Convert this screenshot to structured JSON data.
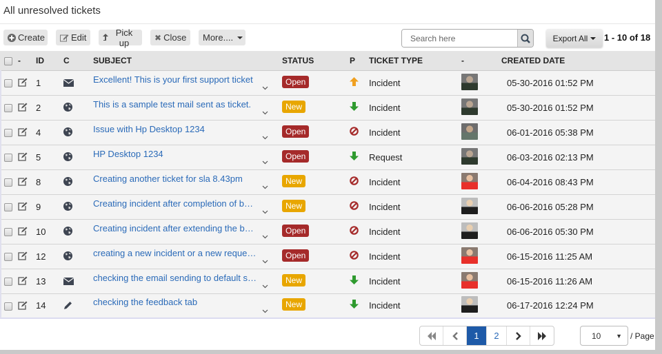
{
  "page": {
    "title": "All unresolved tickets"
  },
  "toolbar": {
    "create_label": "Create",
    "edit_label": "Edit",
    "pickup_label": "Pick up",
    "close_label": "Close",
    "more_label": "More....",
    "search_placeholder": "Search here",
    "export_label": "Export All",
    "count_text": "1 - 10 of 18"
  },
  "table": {
    "headers": {
      "dash1": "-",
      "id": "ID",
      "c": "C",
      "subject": "SUBJECT",
      "status": "STATUS",
      "p": "P",
      "ticket_type": "TICKET TYPE",
      "dash2": "-",
      "created_date": "CREATED DATE"
    },
    "rows": [
      {
        "id": "1",
        "channel": "email-icon",
        "subject": "Excellent! This is your first support ticket",
        "status": "Open",
        "priority": "high-arrow-up-icon",
        "type": "Incident",
        "avatar": "m",
        "created": "05-30-2016 01:52 PM"
      },
      {
        "id": "2",
        "channel": "globe-icon",
        "subject": "This is a sample test mail sent as ticket.",
        "status": "New",
        "priority": "low-arrow-down-icon",
        "type": "Incident",
        "avatar": "m",
        "created": "05-30-2016 01:52 PM"
      },
      {
        "id": "4",
        "channel": "globe-icon",
        "subject": "Issue with Hp Desktop 1234",
        "status": "Open",
        "priority": "none-ban-icon",
        "type": "Incident",
        "avatar": "m2",
        "created": "06-01-2016 05:38 PM"
      },
      {
        "id": "5",
        "channel": "globe-icon",
        "subject": "HP Desktop 1234",
        "status": "Open",
        "priority": "low-arrow-down-icon",
        "type": "Request",
        "avatar": "m",
        "created": "06-03-2016 02:13 PM"
      },
      {
        "id": "8",
        "channel": "globe-icon",
        "subject": "Creating another ticket for sla 8.43pm",
        "status": "New",
        "priority": "none-ban-icon",
        "type": "Incident",
        "avatar": "fr",
        "created": "06-04-2016 08:43 PM"
      },
      {
        "id": "9",
        "channel": "globe-icon",
        "subject": "Creating incident after completion of busi...",
        "status": "New",
        "priority": "none-ban-icon",
        "type": "Incident",
        "avatar": "fb",
        "created": "06-06-2016 05:28 PM"
      },
      {
        "id": "10",
        "channel": "globe-icon",
        "subject": "Creating incident after extending the busi...",
        "status": "Open",
        "priority": "none-ban-icon",
        "type": "Incident",
        "avatar": "fb",
        "created": "06-06-2016 05:30 PM"
      },
      {
        "id": "12",
        "channel": "globe-icon",
        "subject": "creating a new incident or a new request...",
        "status": "Open",
        "priority": "none-ban-icon",
        "type": "Incident",
        "avatar": "fr",
        "created": "06-15-2016 11:25 AM"
      },
      {
        "id": "13",
        "channel": "email-icon",
        "subject": "checking the email sending to default sup...",
        "status": "New",
        "priority": "low-arrow-down-icon",
        "type": "Incident",
        "avatar": "fr",
        "created": "06-15-2016 11:26 AM"
      },
      {
        "id": "14",
        "channel": "pencil-icon",
        "subject": "checking the feedback tab",
        "status": "New",
        "priority": "low-arrow-down-icon",
        "type": "Incident",
        "avatar": "fb",
        "created": "06-17-2016 12:24 PM"
      }
    ]
  },
  "status_colors": {
    "Open": "#a52a2a",
    "New": "#e8a600"
  },
  "priority_colors": {
    "high": "#f0a020",
    "low": "#2e9a2e",
    "none": "#a52a2a"
  },
  "pagination": {
    "first_icon": "double-chevron-left-icon",
    "prev_icon": "chevron-left-icon",
    "pages": [
      "1",
      "2"
    ],
    "current_page": "1",
    "next_icon": "chevron-right-icon",
    "last_icon": "double-chevron-right-icon",
    "per_page_value": "10",
    "per_page_label": "/ Page"
  }
}
